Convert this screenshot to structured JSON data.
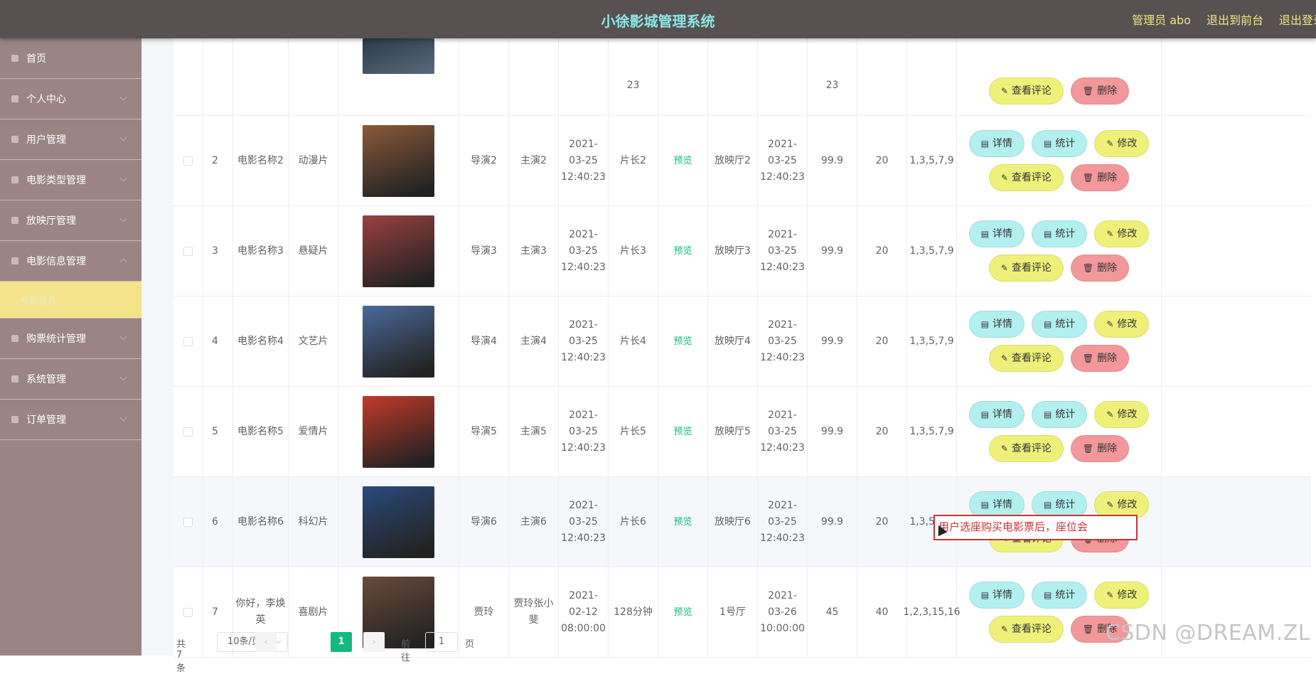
{
  "header": {
    "title": "小徐影城管理系统",
    "admin": "管理员 abo",
    "front": "退出到前台",
    "logout": "退出登录"
  },
  "sidebar": {
    "items": [
      {
        "label": "首页",
        "icon": "home-icon"
      },
      {
        "label": "个人中心",
        "icon": "user-icon"
      },
      {
        "label": "用户管理",
        "icon": "users-icon"
      },
      {
        "label": "电影类型管理",
        "icon": "film-type-icon"
      },
      {
        "label": "放映厅管理",
        "icon": "hall-icon"
      },
      {
        "label": "电影信息管理",
        "icon": "film-info-icon"
      },
      {
        "label": "购票统计管理",
        "icon": "stats-icon"
      },
      {
        "label": "系统管理",
        "icon": "system-icon"
      },
      {
        "label": "订单管理",
        "icon": "order-icon"
      }
    ],
    "sub_item": "电影信息"
  },
  "table": {
    "top_partial": {
      "date_tail": "23",
      "end_tail": "23"
    },
    "rows": [
      {
        "id": "2",
        "name": "电影名称2",
        "type": "动漫片",
        "director": "导演2",
        "actor": "主演2",
        "release": "2021-03-25 12:40:23",
        "duration": "片长2",
        "preview": "预览",
        "hall": "放映厅2",
        "showtime": "2021-03-25 12:40:23",
        "price": "99.9",
        "seats": "20",
        "sold": "1,3,5,7,9",
        "poster_color": "#8a5a3a"
      },
      {
        "id": "3",
        "name": "电影名称3",
        "type": "悬疑片",
        "director": "导演3",
        "actor": "主演3",
        "release": "2021-03-25 12:40:23",
        "duration": "片长3",
        "preview": "预览",
        "hall": "放映厅3",
        "showtime": "2021-03-25 12:40:23",
        "price": "99.9",
        "seats": "20",
        "sold": "1,3,5,7,9",
        "poster_color": "#9a4040"
      },
      {
        "id": "4",
        "name": "电影名称4",
        "type": "文艺片",
        "director": "导演4",
        "actor": "主演4",
        "release": "2021-03-25 12:40:23",
        "duration": "片长4",
        "preview": "预览",
        "hall": "放映厅4",
        "showtime": "2021-03-25 12:40:23",
        "price": "99.9",
        "seats": "20",
        "sold": "1,3,5,7,9",
        "poster_color": "#4a6a9a"
      },
      {
        "id": "5",
        "name": "电影名称5",
        "type": "爱情片",
        "director": "导演5",
        "actor": "主演5",
        "release": "2021-03-25 12:40:23",
        "duration": "片长5",
        "preview": "预览",
        "hall": "放映厅5",
        "showtime": "2021-03-25 12:40:23",
        "price": "99.9",
        "seats": "20",
        "sold": "1,3,5,7,9",
        "poster_color": "#c23a2a"
      },
      {
        "id": "6",
        "name": "电影名称6",
        "type": "科幻片",
        "director": "导演6",
        "actor": "主演6",
        "release": "2021-03-25 12:40:23",
        "duration": "片长6",
        "preview": "预览",
        "hall": "放映厅6",
        "showtime": "2021-03-25 12:40:23",
        "price": "99.9",
        "seats": "20",
        "sold": "1,3,5,7,9",
        "poster_color": "#2a4a7a"
      },
      {
        "id": "7",
        "name": "你好，李焕英",
        "type": "喜剧片",
        "director": "贾玲",
        "actor": "贾玲张小斐",
        "release": "2021-02-12 08:00:00",
        "duration": "128分钟",
        "preview": "预览",
        "hall": "1号厅",
        "showtime": "2021-03-26 10:00:00",
        "price": "45",
        "seats": "40",
        "sold": "1,2,3,15,16",
        "poster_color": "#6a4a3a"
      }
    ],
    "buttons": {
      "detail": "详情",
      "stats": "统计",
      "edit": "修改",
      "comments": "查看评论",
      "delete": "删除"
    }
  },
  "pagination": {
    "total": "共 7 条",
    "page_size": "10条/页",
    "current": "1",
    "goto_label": "前往",
    "goto_value": "1",
    "page_label": "页",
    "prev": "‹",
    "next": "›"
  },
  "tooltip": "用户选座购买电影票后，座位会",
  "watermark": "CSDN @DREAM.ZL"
}
